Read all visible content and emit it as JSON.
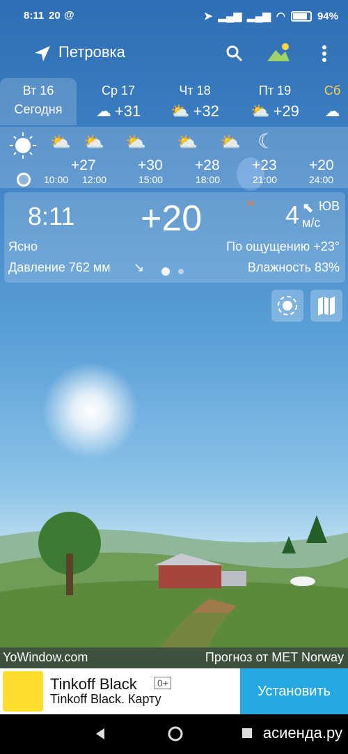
{
  "status_bar": {
    "time": "8:11",
    "temp": "20",
    "at_sign": "@",
    "battery": "94%"
  },
  "app_bar": {
    "city": "Петровка"
  },
  "days": [
    {
      "name": "Вт 16",
      "sub": "Сегодня",
      "temp": ""
    },
    {
      "name": "Ср 17",
      "sub": "",
      "temp": "+31"
    },
    {
      "name": "Чт 18",
      "sub": "",
      "temp": "+32"
    },
    {
      "name": "Пт 19",
      "sub": "",
      "temp": "+29"
    },
    {
      "name": "Сб",
      "sub": "",
      "temp": ""
    }
  ],
  "hourly": {
    "temps": [
      "+27",
      "+30",
      "+28",
      "+23",
      "+20"
    ],
    "times": [
      "10:00",
      "12:00",
      "15:00",
      "18:00",
      "21:00",
      "24:00"
    ]
  },
  "current": {
    "time": "8:11",
    "temp": "+20",
    "wind_speed": "4",
    "wind_dir": "ЮВ",
    "wind_unit": "м/с",
    "condition": "Ясно",
    "feels_like": "По ощущению +23°",
    "pressure": "Давление 762 мм",
    "humidity": "Влажность 83%"
  },
  "footer": {
    "left": "YoWindow.com",
    "right": "Прогноз от MET Norway"
  },
  "ad": {
    "title": "Tinkoff Black",
    "age": "0+",
    "subtitle": "Tinkoff Black. Карту",
    "button": "Установить"
  },
  "watermark": "асиенда.ру",
  "icons": [
    "location-arrow-icon",
    "search-icon",
    "landscape-icon",
    "more-icon",
    "sun-icon",
    "sun-cloud-icon",
    "moon-icon",
    "radar-icon",
    "map-icon",
    "back-icon",
    "home-icon",
    "recents-icon"
  ]
}
